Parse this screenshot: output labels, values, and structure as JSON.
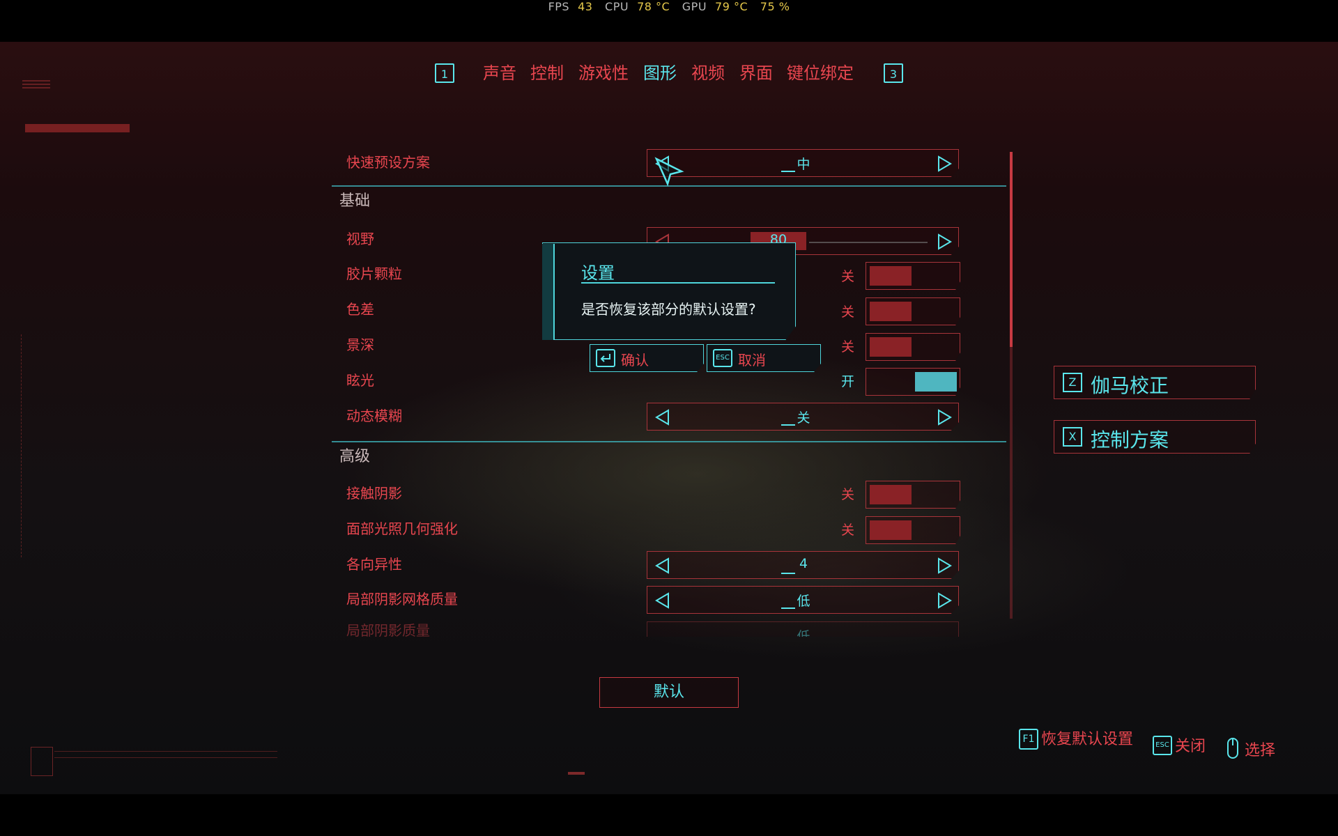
{
  "perf": {
    "fps_label": "FPS",
    "fps_value": "43",
    "cpu_label": "CPU",
    "cpu_value": "78 °C",
    "gpu_label": "GPU",
    "gpu_value": "79 °C",
    "gpu_load": "75 %"
  },
  "tabs": {
    "prev_key": "1",
    "next_key": "3",
    "items": [
      {
        "label": "声音",
        "active": false
      },
      {
        "label": "控制",
        "active": false
      },
      {
        "label": "游戏性",
        "active": false
      },
      {
        "label": "图形",
        "active": true
      },
      {
        "label": "视频",
        "active": false
      },
      {
        "label": "界面",
        "active": false
      },
      {
        "label": "键位绑定",
        "active": false
      }
    ]
  },
  "settings": {
    "preset": {
      "label": "快速预设方案",
      "value": "中"
    },
    "sections": [
      {
        "title": "基础"
      },
      {
        "title": "高级"
      }
    ],
    "fov": {
      "label": "视野",
      "value": "80"
    },
    "film_grain": {
      "label": "胶片颗粒",
      "state": "关"
    },
    "chromatic": {
      "label": "色差",
      "state": "关"
    },
    "dof": {
      "label": "景深",
      "state": "关"
    },
    "glare": {
      "label": "眩光",
      "state": "开"
    },
    "motion_blur": {
      "label": "动态模糊",
      "value": "关"
    },
    "contact_shadows": {
      "label": "接触阴影",
      "state": "关"
    },
    "face_lighting": {
      "label": "面部光照几何强化",
      "state": "关"
    },
    "anisotropy": {
      "label": "各向异性",
      "value": "4"
    },
    "local_shadow_mesh": {
      "label": "局部阴影网格质量",
      "value": "低"
    },
    "local_shadow_quality": {
      "label": "局部阴影质量",
      "value": "低"
    }
  },
  "side_buttons": {
    "gamma": {
      "key": "Z",
      "label": "伽马校正"
    },
    "control_scheme": {
      "key": "X",
      "label": "控制方案"
    }
  },
  "default_button": "默认",
  "hints": {
    "restore_key": "F1",
    "restore_label": "恢复默认设置",
    "close_key": "ESC",
    "close_label": "关闭",
    "select_label": "选择"
  },
  "dialog": {
    "title": "设置",
    "message": "是否恢复该部分的默认设置?",
    "confirm_label": "确认",
    "cancel_key": "ESC",
    "cancel_label": "取消"
  },
  "colors": {
    "accent_red": "#e8464f",
    "accent_cyan": "#5ae6ec",
    "toggle_on": "#4fb6c0",
    "toggle_off": "#8a2226"
  }
}
